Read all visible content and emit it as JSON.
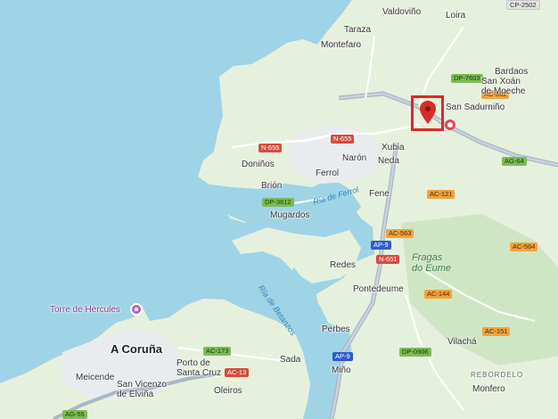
{
  "places": {
    "valdovino": "Valdoviño",
    "loira": "Loira",
    "taraza": "Taraza",
    "montefaro": "Montefaro",
    "bardaos": "Bardaos",
    "san_xoan": "San Xoán\nde Moeche",
    "san_sadurnino": "San Sadurniño",
    "donino": "Doniños",
    "naron": "Narón",
    "xubia": "Xubia",
    "neda": "Neda",
    "ferrol": "Ferrol",
    "brion": "Brión",
    "mugardos": "Mugardos",
    "fene": "Fene",
    "redes": "Redes",
    "pontedeume": "Pontedeume",
    "perbes": "Perbes",
    "vilacha": "Vilachá",
    "sada": "Sada",
    "mino": "Miño",
    "a_coruna": "A Coruña",
    "meicende": "Meicende",
    "san_vicenzo": "San Vicenzo\nde Elviña",
    "porto_santa_cruz": "Porto de\nSanta Cruz",
    "oleiros": "Oleiros",
    "monfero": "Monfero"
  },
  "areas": {
    "rebordelo": "REBORDELO"
  },
  "water": {
    "ria_ferrol": "Ría de Ferrol",
    "ria_betanzos": "Ría de Betanzos"
  },
  "park": {
    "fragas": "Fragas\ndo Eume"
  },
  "poi": {
    "torre": "Torre de Hercules"
  },
  "roads": {
    "cp2502": "CP-2502",
    "dp7603": "DP-7603",
    "ac862": "AC-862",
    "ag64": "AG-64",
    "n655a": "N-655",
    "n655b": "N-655",
    "dp3612": "DP-3612",
    "ac121": "AC-121",
    "ac563": "AC-563",
    "ap9a": "AP-9",
    "n651": "N-651",
    "ac564": "AC-564",
    "ac144": "AC-144",
    "ac151": "AC-151",
    "ap9b": "AP-9",
    "dp0906": "DP-0906",
    "ac173": "AC-173",
    "ac13": "AC-13",
    "ag55": "AG-55"
  },
  "colors": {
    "water": "#9fd3e6",
    "land": "#e6f1dd",
    "urban": "#e9ecef",
    "road": "#ffffff",
    "highway": "#a9b7c6",
    "marker": "#d92a2a"
  },
  "icons": {
    "selected_marker": "map-pin-icon",
    "secondary_marker": "location-dot-icon",
    "poi": "landmark-icon"
  }
}
